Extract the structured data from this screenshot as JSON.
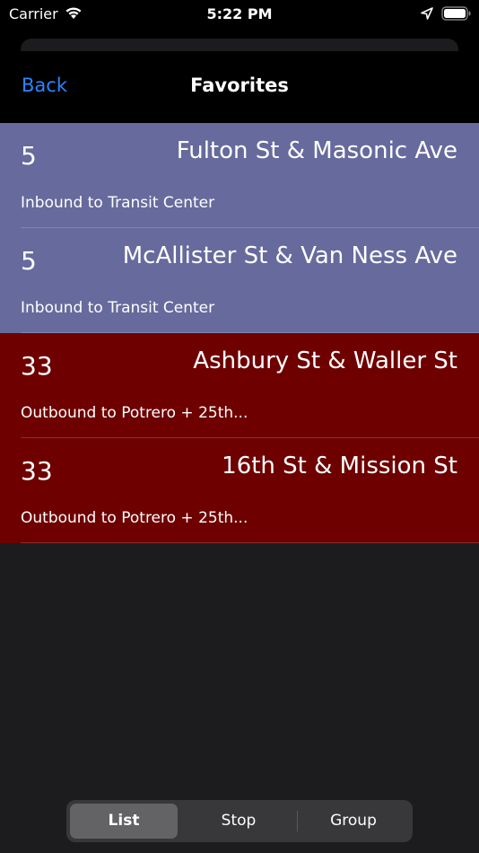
{
  "status_bar": {
    "carrier": "Carrier",
    "time": "5:22 PM",
    "wifi_icon": "wifi-icon",
    "location_icon": "location-arrow-icon",
    "battery_icon": "battery-icon"
  },
  "nav": {
    "back_label": "Back",
    "title": "Favorites",
    "accent_color": "#2c84ff"
  },
  "favorites": [
    {
      "route": "5",
      "stop": "Fulton St & Masonic Ave",
      "direction": "Inbound to Transit Center",
      "color": "#676a9c"
    },
    {
      "route": "5",
      "stop": "McAllister St & Van Ness Ave",
      "direction": "Inbound to Transit Center",
      "color": "#676a9c"
    },
    {
      "route": "33",
      "stop": "Ashbury St & Waller St",
      "direction": "Outbound to Potrero + 25th...",
      "color": "#6e0000"
    },
    {
      "route": "33",
      "stop": "16th St & Mission St",
      "direction": "Outbound to Potrero + 25th...",
      "color": "#6e0000"
    }
  ],
  "segmented_control": {
    "options": [
      "List",
      "Stop",
      "Group"
    ],
    "selected": "List"
  }
}
